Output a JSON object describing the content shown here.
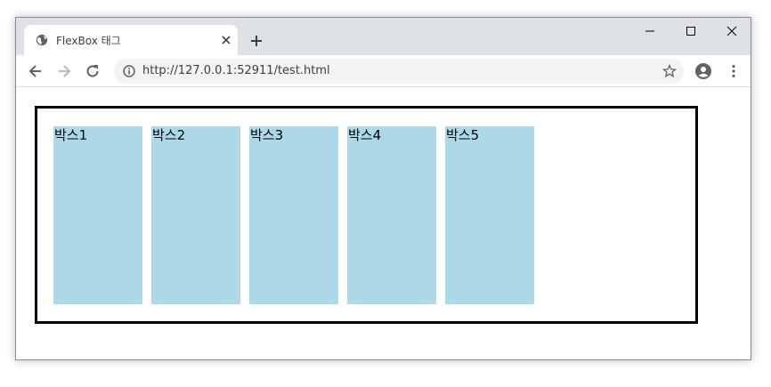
{
  "browser": {
    "tab_title": "FlexBox 태그",
    "url": "http://127.0.0.1:52911/test.html",
    "icons": {
      "favicon": "globe-icon",
      "tab_close": "close-icon",
      "new_tab": "plus-icon",
      "minimize": "minimize-icon",
      "maximize": "maximize-icon",
      "close": "close-icon",
      "back": "back-arrow-icon",
      "forward": "forward-arrow-icon",
      "reload": "reload-icon",
      "site_info": "info-icon",
      "bookmark": "star-icon",
      "profile": "account-icon",
      "menu": "kebab-menu-icon"
    }
  },
  "page": {
    "boxes": [
      "박스1",
      "박스2",
      "박스3",
      "박스4",
      "박스5"
    ],
    "box_color": "#add8e6",
    "border_color": "#000000"
  }
}
